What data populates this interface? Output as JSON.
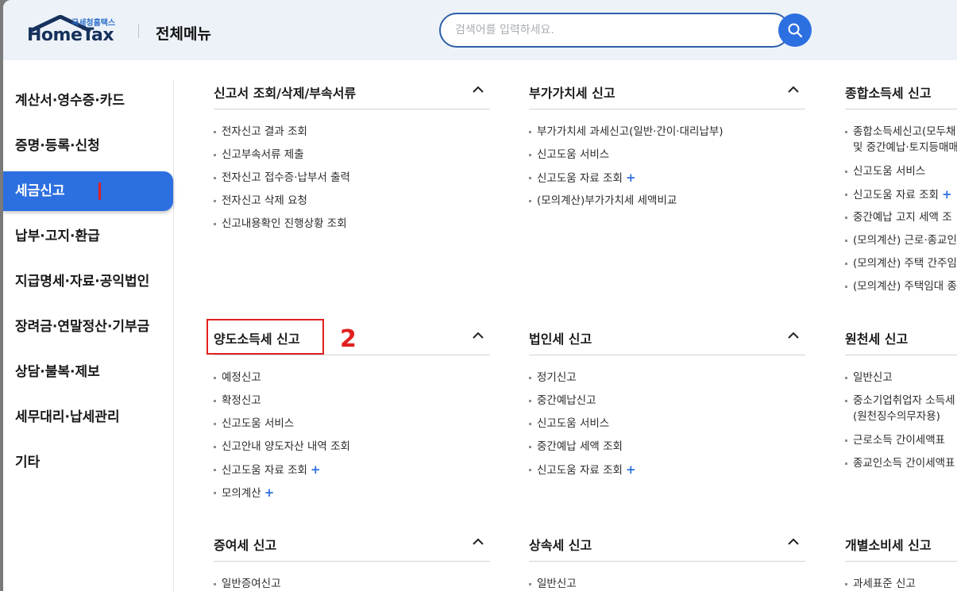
{
  "header": {
    "logo_sub": "국세청홈택스",
    "logo_main": "HomeTax",
    "title": "전체메뉴",
    "search_placeholder": "검색어를 입력하세요."
  },
  "sidebar": {
    "items": [
      {
        "label": "계산서·영수증·카드"
      },
      {
        "label": "증명·등록·신청"
      },
      {
        "label": "세금신고"
      },
      {
        "label": "납부·고지·환급"
      },
      {
        "label": "지급명세·자료·공익법인"
      },
      {
        "label": "장려금·연말정산·기부금"
      },
      {
        "label": "상담·불복·제보"
      },
      {
        "label": "세무대리·납세관리"
      },
      {
        "label": "기타"
      }
    ],
    "active_index": 2
  },
  "annotations": {
    "number_2": "2"
  },
  "sections": [
    {
      "title": "신고서 조회/삭제/부속서류",
      "items": [
        {
          "label": "전자신고 결과 조회"
        },
        {
          "label": "신고부속서류 제출"
        },
        {
          "label": "전자신고 접수증·납부서 출력"
        },
        {
          "label": "전자신고 삭제 요청"
        },
        {
          "label": "신고내용확인 진행상황 조회"
        }
      ]
    },
    {
      "title": "부가가치세 신고",
      "items": [
        {
          "label": "부가가치세 과세신고(일반·간이·대리납부)"
        },
        {
          "label": "신고도움 서비스"
        },
        {
          "label": "신고도움 자료 조회",
          "plus": "+"
        },
        {
          "label": "(모의계산)부가가치세 세액비교"
        }
      ]
    },
    {
      "title": "종합소득세 신고",
      "items": [
        {
          "label": "종합소득세신고(모두채",
          "label2": "및 중간예납·토지등매매"
        },
        {
          "label": "신고도움 서비스"
        },
        {
          "label": "신고도움 자료 조회",
          "plus": "+"
        },
        {
          "label": "중간예납 고지 세액 조"
        },
        {
          "label": "(모의계산) 근로·종교인"
        },
        {
          "label": "(모의계산) 주택 간주임"
        },
        {
          "label": "(모의계산) 주택임대 종"
        }
      ]
    },
    {
      "title": "양도소득세 신고",
      "items": [
        {
          "label": "예정신고"
        },
        {
          "label": "확정신고"
        },
        {
          "label": "신고도움 서비스"
        },
        {
          "label": "신고안내 양도자산 내역 조회"
        },
        {
          "label": "신고도움 자료 조회",
          "plus": "+"
        },
        {
          "label": "모의계산",
          "plus": "+"
        }
      ]
    },
    {
      "title": "법인세 신고",
      "items": [
        {
          "label": "정기신고"
        },
        {
          "label": "중간예납신고"
        },
        {
          "label": "신고도움 서비스"
        },
        {
          "label": "중간예납 세액 조회"
        },
        {
          "label": "신고도움 자료 조회",
          "plus": "+"
        }
      ]
    },
    {
      "title": "원천세 신고",
      "items": [
        {
          "label": "일반신고"
        },
        {
          "label": "중소기업취업자 소득세",
          "label2": "(원천징수의무자용)"
        },
        {
          "label": "근로소득 간이세액표"
        },
        {
          "label": "종교인소득 간이세액표"
        }
      ]
    },
    {
      "title": "증여세 신고",
      "items": [
        {
          "label": "일반증여신고"
        }
      ]
    },
    {
      "title": "상속세 신고",
      "items": [
        {
          "label": "일반신고"
        }
      ]
    },
    {
      "title": "개별소비세 신고",
      "items": [
        {
          "label": "과세표준 신고"
        }
      ]
    }
  ],
  "colors": {
    "accent": "#2c6fe0",
    "annotation_red": "#e02020",
    "header_bg": "#edf2f9"
  }
}
